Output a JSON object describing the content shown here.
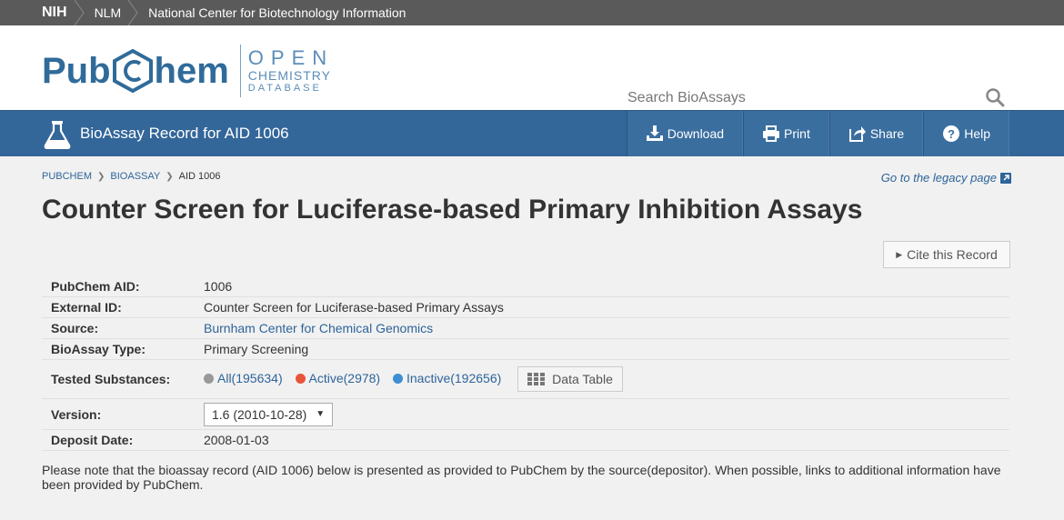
{
  "nih_bar": {
    "crumbs": [
      "NIH",
      "NLM",
      "National Center for Biotechnology Information"
    ]
  },
  "logo": {
    "pub": "Pub",
    "chem": "hem",
    "open": "OPEN",
    "chemistry": "CHEMISTRY",
    "database": "DATABASE"
  },
  "search": {
    "placeholder": "Search BioAssays"
  },
  "blue_bar": {
    "title": "BioAssay Record for AID 1006",
    "actions": {
      "download": "Download",
      "print": "Print",
      "share": "Share",
      "help": "Help"
    }
  },
  "breadcrumb": [
    "PUBCHEM",
    "BIOASSAY",
    "AID 1006"
  ],
  "legacy_link": "Go to the legacy page",
  "page_title": "Counter Screen for Luciferase-based Primary Inhibition Assays",
  "cite_label": "Cite this Record",
  "info": {
    "aid_label": "PubChem AID:",
    "aid_value": "1006",
    "external_label": "External ID:",
    "external_value": "Counter Screen for Luciferase-based Primary Assays",
    "source_label": "Source:",
    "source_value": "Burnham Center for Chemical Genomics",
    "type_label": "BioAssay Type:",
    "type_value": "Primary Screening",
    "tested_label": "Tested Substances:",
    "tested": {
      "all": "All(195634)",
      "active": "Active(2978)",
      "inactive": "Inactive(192656)",
      "data_table": "Data Table"
    },
    "version_label": "Version:",
    "version_value": "1.6 (2010-10-28)",
    "deposit_label": "Deposit Date:",
    "deposit_value": "2008-01-03"
  },
  "note": "Please note that the bioassay record (AID 1006) below is presented as provided to PubChem by the source(depositor). When possible, links to additional information have been provided by PubChem.",
  "colors": {
    "brand_blue": "#336699",
    "link": "#2e6499",
    "all_dot": "#999999",
    "active_dot": "#e8553a",
    "inactive_dot": "#3d8fd1"
  }
}
